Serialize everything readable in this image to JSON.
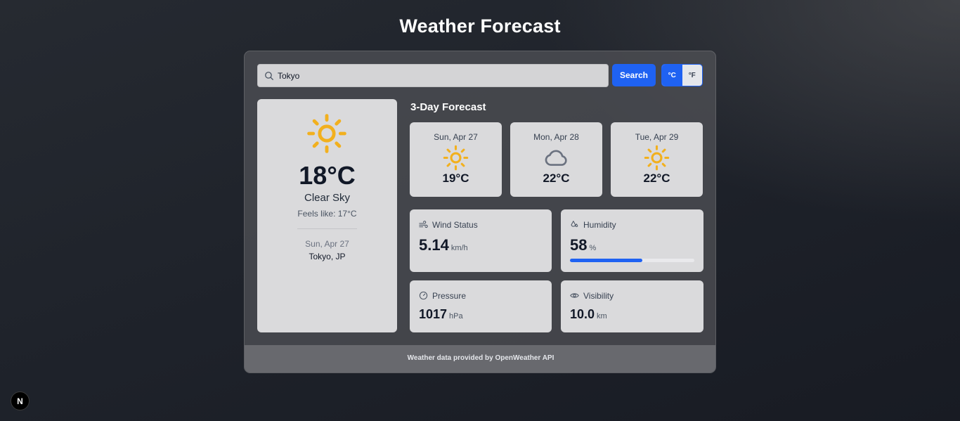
{
  "app": {
    "title": "Weather Forecast"
  },
  "search": {
    "value": "Tokyo",
    "button_label": "Search"
  },
  "units": {
    "celsius_label": "°C",
    "fahrenheit_label": "°F",
    "selected": "celsius"
  },
  "current": {
    "icon": "sun-icon",
    "temperature": "18°C",
    "condition": "Clear Sky",
    "feels_like": "Feels like: 17°C",
    "date": "Sun, Apr 27",
    "location": "Tokyo, JP"
  },
  "forecast": {
    "title": "3-Day Forecast",
    "days": [
      {
        "date": "Sun, Apr 27",
        "icon": "sun-icon",
        "temp": "19°C"
      },
      {
        "date": "Mon, Apr 28",
        "icon": "cloud-icon",
        "temp": "22°C"
      },
      {
        "date": "Tue, Apr 29",
        "icon": "sun-icon",
        "temp": "22°C"
      }
    ]
  },
  "stats": {
    "wind": {
      "label": "Wind Status",
      "value": "5.14",
      "unit": "km/h",
      "icon": "wind-icon"
    },
    "humidity": {
      "label": "Humidity",
      "value": "58",
      "unit": "%",
      "icon": "droplet-icon",
      "level": 0.58
    },
    "pressure": {
      "label": "Pressure",
      "value": "1017",
      "unit": "hPa",
      "icon": "gauge-icon"
    },
    "visibility": {
      "label": "Visibility",
      "value": "10.0",
      "unit": "km",
      "icon": "eye-icon"
    }
  },
  "footer": {
    "text": "Weather data provided by OpenWeather API"
  },
  "badge": {
    "text": "N"
  },
  "colors": {
    "accent": "#1f62f2",
    "sun": "#f2b01e",
    "cloud": "#6b7280"
  }
}
